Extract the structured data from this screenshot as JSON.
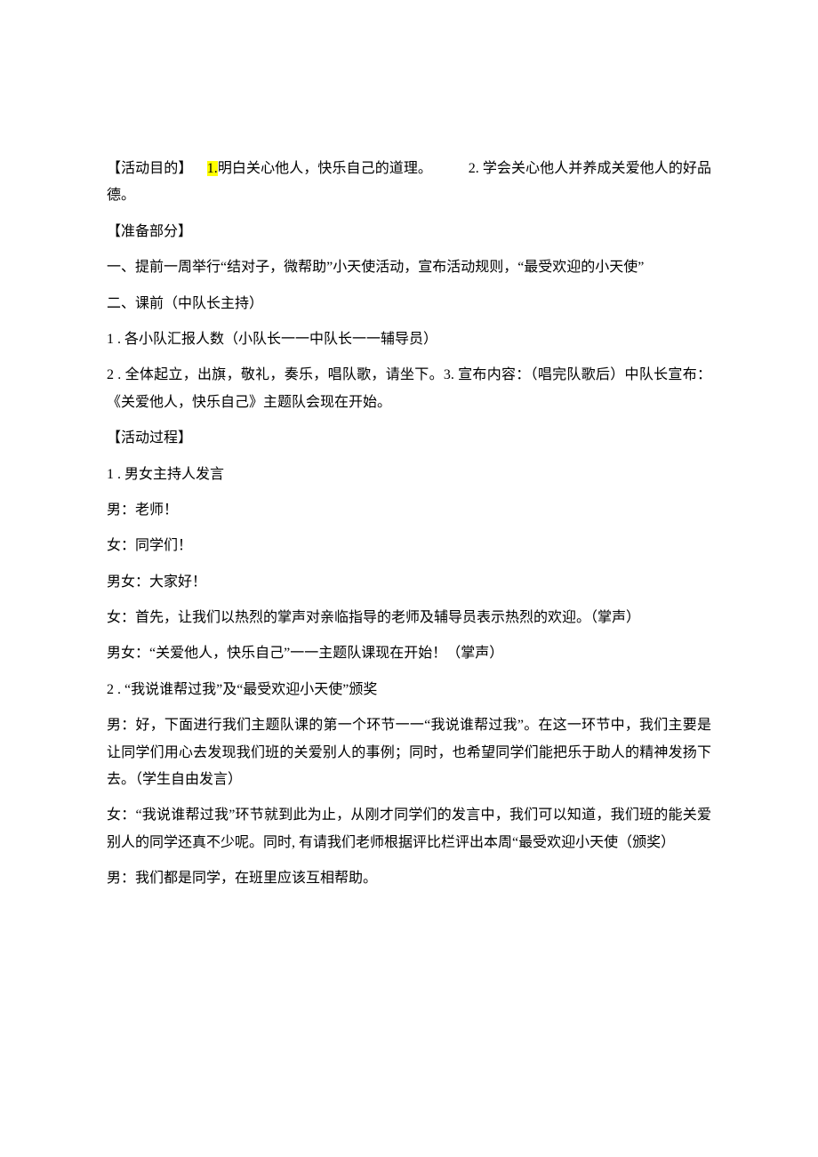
{
  "content": {
    "p1_label": "【活动目的】",
    "p1_hl": "1.",
    "p1_part1": "明白关心他人，快乐自己的道理。",
    "p1_part2": "2. 学会关心他人并养成关爱他人的好品德。",
    "p2": "【准备部分】",
    "p3": "一、提前一周举行“结对子，微帮助”小天使活动，宣布活动规则，“最受欢迎的小天使”",
    "p4": "二、课前（中队长主持）",
    "p5": "1 . 各小队汇报人数（小队长一一中队长一一辅导员）",
    "p6": "2 . 全体起立，出旗，敬礼，奏乐，唱队歌，请坐下。3. 宣布内容：（唱完队歌后）中队长宣布：《关爱他人，快乐自己》主题队会现在开始。",
    "p7": "【活动过程】",
    "p8": "1 . 男女主持人发言",
    "p9": "男：老师！",
    "p10": "女：同学们！",
    "p11": "男女：大家好！",
    "p12": "女：首先，让我们以热烈的掌声对亲临指导的老师及辅导员表示热烈的欢迎。（掌声）",
    "p13": "男女：“关爱他人，快乐自己”一一主题队课现在开始！（掌声）",
    "p14": "2 . “我说谁帮过我”及“最受欢迎小天使”颁奖",
    "p15": "男：好，下面进行我们主题队课的第一个环节一一“我说谁帮过我”。在这一环节中，我们主要是让同学们用心去发现我们班的关爱别人的事例；同时，也希望同学们能把乐于助人的精神发扬下去。（学生自由发言）",
    "p16": "女：“我说谁帮过我”环节就到此为止，从刚才同学们的发言中，我们可以知道，我们班的能关爱别人的同学还真不少呢。同时, 有请我们老师根据评比栏评出本周“最受欢迎小天使（颁奖）",
    "p17": "男：我们都是同学，在班里应该互相帮助。"
  }
}
